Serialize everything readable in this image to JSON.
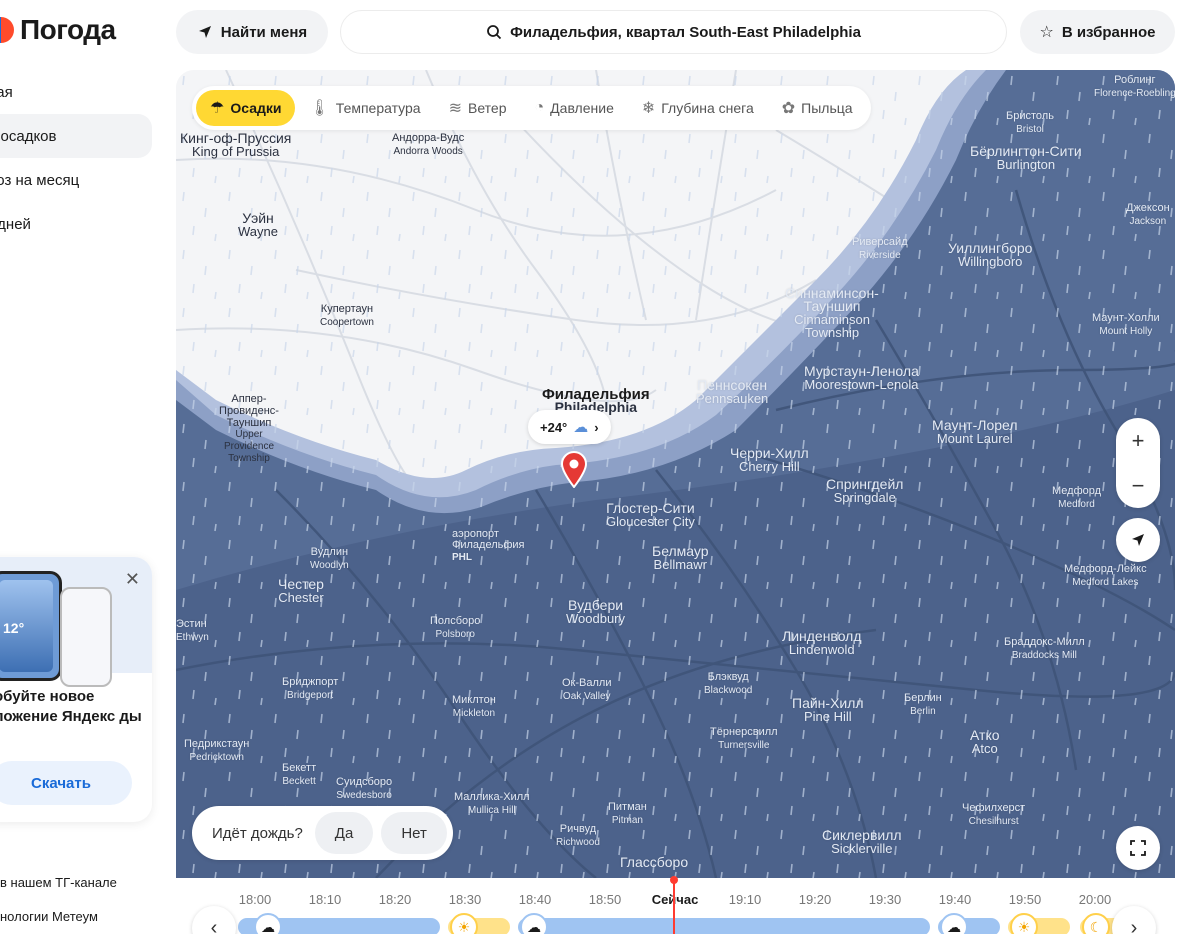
{
  "app": {
    "title": "Погода"
  },
  "sidebar": {
    "items": [
      {
        "label": "ная"
      },
      {
        "label": "а осадков"
      },
      {
        "label": "ноз на месяц"
      },
      {
        "label": ") дней"
      },
      {
        "label": "✓"
      }
    ],
    "active_index": 1,
    "promo": {
      "phone_temp": "12°",
      "text": "обуйте новое ложение Яндекс ды",
      "download": "Скачать"
    },
    "footer": [
      {
        "label": "в нашем ТГ-канале"
      },
      {
        "label": "нологии Метеум"
      }
    ]
  },
  "header": {
    "find_me": "Найти меня",
    "search_value": "Филадельфия, квартал South-East Philadelphia",
    "favorite": "В избранное"
  },
  "map": {
    "layers": [
      {
        "label": "Осадки",
        "icon": "precipitation-icon",
        "active": true
      },
      {
        "label": "Температура",
        "icon": "thermometer-icon",
        "active": false
      },
      {
        "label": "Ветер",
        "icon": "wind-icon",
        "active": false
      },
      {
        "label": "Давление",
        "icon": "pressure-icon",
        "active": false
      },
      {
        "label": "Глубина снега",
        "icon": "snowflake-icon",
        "active": false
      },
      {
        "label": "Пыльца",
        "icon": "pollen-icon",
        "active": false
      }
    ],
    "temp_chip": "+24°",
    "places": [
      {
        "ru": "Кинг-оф-Пруссия",
        "en": "King of Prussia"
      },
      {
        "ru": "Андорра-Вудс",
        "en": "Andorra Woods"
      },
      {
        "ru": "Уэйн",
        "en": "Wayne"
      },
      {
        "ru": "Купертаун",
        "en": "Coopertown"
      },
      {
        "ru": "Аппер-Провиденс-Тауншип",
        "en": "Upper Providence Township"
      },
      {
        "ru": "Филадельфия",
        "en": "Philadelphia"
      },
      {
        "ru": "Пеннсокен",
        "en": "Pennsauken"
      },
      {
        "ru": "Синнаминсон-Тауншип",
        "en": "Cinnaminson Township"
      },
      {
        "ru": "Риверсайд",
        "en": "Riverside"
      },
      {
        "ru": "Уиллингборо",
        "en": "Willingboro"
      },
      {
        "ru": "Бёрлингтон-Сити",
        "en": "Burlington"
      },
      {
        "ru": "Бристоль",
        "en": "Bristol"
      },
      {
        "ru": "Роблинг",
        "en": "Florence-Roebling"
      },
      {
        "ru": "Джексон",
        "en": "Jackson"
      },
      {
        "ru": "Маунт-Холли",
        "en": "Mount Holly"
      },
      {
        "ru": "Мурстаун-Ленола",
        "en": "Moorestown-Lenola"
      },
      {
        "ru": "Маунт-Лорел",
        "en": "Mount Laurel"
      },
      {
        "ru": "Черри-Хилл",
        "en": "Cherry Hill"
      },
      {
        "ru": "Спрингдейл",
        "en": "Springdale"
      },
      {
        "ru": "Медфорд",
        "en": "Medford"
      },
      {
        "ru": "Медфорд-Лейкс",
        "en": "Medford Lakes"
      },
      {
        "ru": "Глостер-Сити",
        "en": "Gloucester City"
      },
      {
        "ru": "аэропорт Филадельфия",
        "en": "PHL"
      },
      {
        "ru": "Вудлин",
        "en": "Woodlyn"
      },
      {
        "ru": "Честер",
        "en": "Chester"
      },
      {
        "ru": "Белмаур",
        "en": "Bellmawr"
      },
      {
        "ru": "Вудбери",
        "en": "Woodbury"
      },
      {
        "ru": "Полсборо",
        "en": "Polsboro"
      },
      {
        "ru": "Линденволд",
        "en": "Lindenwold"
      },
      {
        "ru": "Браддокс-Милл",
        "en": "Braddocks Mill"
      },
      {
        "ru": "Бриджпорт",
        "en": "Bridgeport"
      },
      {
        "ru": "Ок-Валли",
        "en": "Oak Valley"
      },
      {
        "ru": "Блэквуд",
        "en": "Blackwood"
      },
      {
        "ru": "Пайн-Хилл",
        "en": "Pine Hill"
      },
      {
        "ru": "Берлин",
        "en": "Berlin"
      },
      {
        "ru": "Миклтон",
        "en": "Mickleton"
      },
      {
        "ru": "Тёрнерсвилл",
        "en": "Turnersville"
      },
      {
        "ru": "Атко",
        "en": "Atco"
      },
      {
        "ru": "Педрикстаун",
        "en": "Pedricktown"
      },
      {
        "ru": "Бекетт",
        "en": "Beckett"
      },
      {
        "ru": "Суидсборо",
        "en": "Swedesboro"
      },
      {
        "ru": "Маллика-Хилл",
        "en": "Mullica Hill"
      },
      {
        "ru": "Питман",
        "en": "Pitman"
      },
      {
        "ru": "Ричвуд",
        "en": "Richwood"
      },
      {
        "ru": "Чефилхерст",
        "en": "Chesilhurst"
      },
      {
        "ru": "Сиклервилл",
        "en": "Sicklerville"
      },
      {
        "ru": "Глассборо",
        "en": "Glassboro"
      },
      {
        "ru": "Эстин",
        "en": "Ethwyn"
      }
    ],
    "rain_question": "Идёт дождь?",
    "yes": "Да",
    "no": "Нет"
  },
  "timeline": {
    "ticks": [
      "18:00",
      "18:10",
      "18:20",
      "18:30",
      "18:40",
      "18:50",
      "Сейчас",
      "19:10",
      "19:20",
      "19:30",
      "19:40",
      "19:50",
      "20:00"
    ],
    "now_index": 6
  },
  "colors": {
    "rain_heavy": "#4b6189",
    "rain_medium": "#6f86b2",
    "rain_light": "#9fb1d3",
    "accent": "#ffd833",
    "pin": "#e53935",
    "now_line": "#ff3b30"
  }
}
